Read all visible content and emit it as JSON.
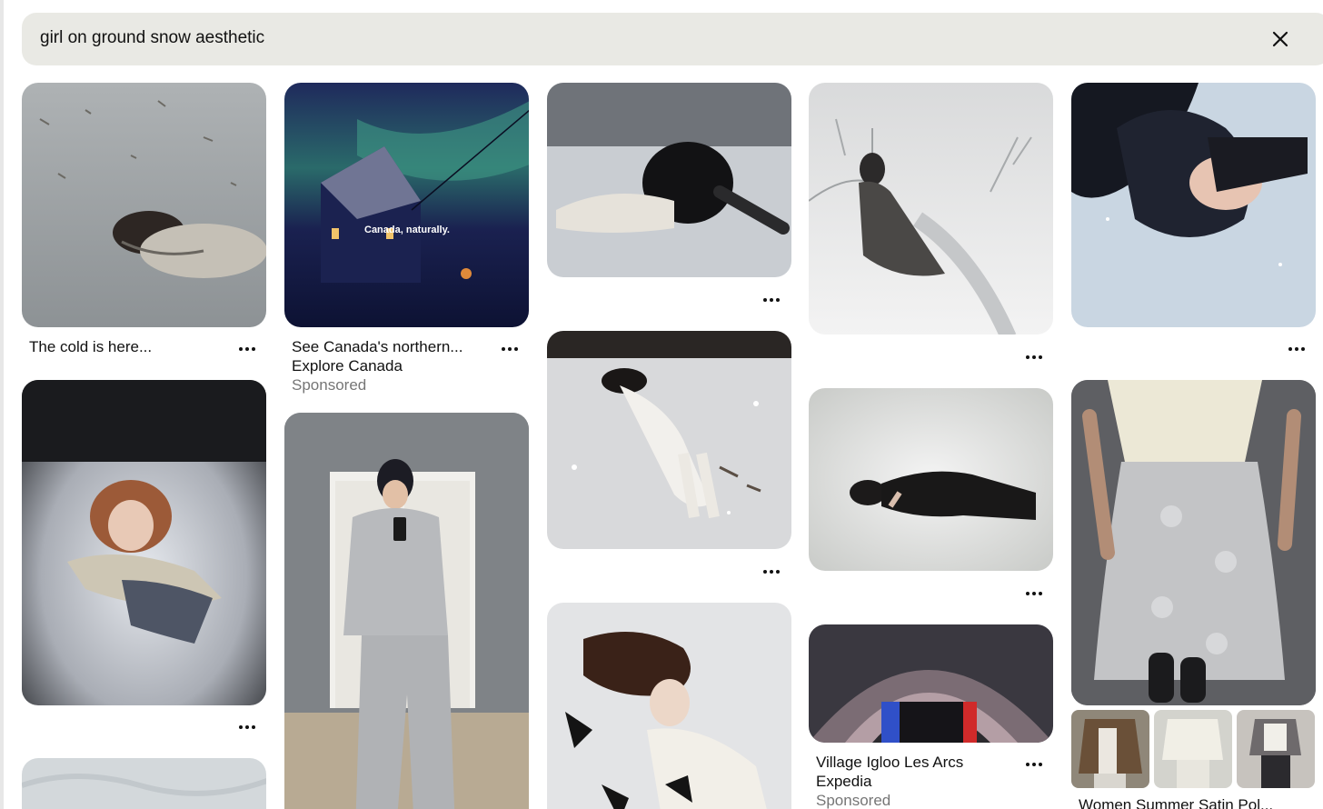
{
  "search": {
    "query": "girl on ground snow aesthetic",
    "clear_icon": "close-icon"
  },
  "pins": {
    "cold_is_here": {
      "title": "The cold is here..."
    },
    "canada_ad": {
      "overlay_text": "Canada, naturally.",
      "title": "See Canada's northern...",
      "advertiser": "Explore Canada",
      "sponsored": "Sponsored"
    },
    "igloo_ad": {
      "title": "Village Igloo Les Arcs",
      "advertiser": "Expedia",
      "sponsored": "Sponsored"
    },
    "satin_skirt": {
      "title": "Women Summer Satin Pol..."
    }
  },
  "icons": {
    "more": "more-options-icon",
    "close": "close-icon"
  },
  "colors": {
    "search_bg": "#e9e9e4",
    "sponsored_text": "#767676",
    "text": "#111111"
  }
}
